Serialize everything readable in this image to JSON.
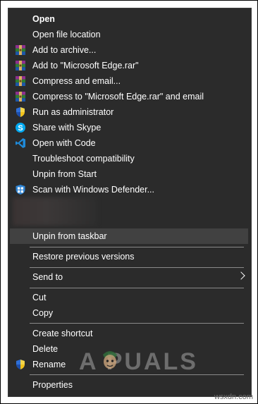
{
  "menu": {
    "items": [
      {
        "label": "Open",
        "icon": null
      },
      {
        "label": "Open file location",
        "icon": null
      },
      {
        "label": "Add to archive...",
        "icon": "winrar-icon"
      },
      {
        "label": "Add to \"Microsoft Edge.rar\"",
        "icon": "winrar-icon"
      },
      {
        "label": "Compress and email...",
        "icon": "winrar-icon"
      },
      {
        "label": "Compress to \"Microsoft Edge.rar\" and email",
        "icon": "winrar-icon"
      },
      {
        "label": "Run as administrator",
        "icon": "uac-shield-icon"
      },
      {
        "label": "Share with Skype",
        "icon": "skype-icon"
      },
      {
        "label": "Open with Code",
        "icon": "vscode-icon"
      },
      {
        "label": "Troubleshoot compatibility",
        "icon": null
      },
      {
        "label": "Unpin from Start",
        "icon": null
      },
      {
        "label": "Scan with Windows Defender...",
        "icon": "windows-defender-icon"
      },
      {
        "label": "Unpin from taskbar",
        "icon": null
      },
      {
        "label": "Restore previous versions",
        "icon": null
      },
      {
        "label": "Send to",
        "icon": "chevron-right-icon"
      },
      {
        "label": "Cut",
        "icon": null
      },
      {
        "label": "Copy",
        "icon": null
      },
      {
        "label": "Create shortcut",
        "icon": null
      },
      {
        "label": "Delete",
        "icon": null
      },
      {
        "label": "Rename",
        "icon": "uac-shield-icon"
      },
      {
        "label": "Properties",
        "icon": null
      }
    ]
  },
  "watermark": "A PUALS",
  "site": "wsxdn.com",
  "colors": {
    "menu_bg": "#2b2b2b",
    "hover_bg": "#414141",
    "text": "#ffffff",
    "separator": "#8a8a8a"
  }
}
